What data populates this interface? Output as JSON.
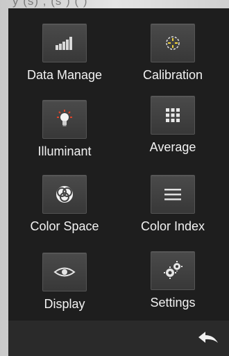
{
  "top_text": "y (s) , (s ) ( )",
  "menu": {
    "items": [
      {
        "label": "Data Manage",
        "icon": "bar-chart-icon"
      },
      {
        "label": "Calibration",
        "icon": "crosshair-icon"
      },
      {
        "label": "Illuminant",
        "icon": "lightbulb-icon"
      },
      {
        "label": "Average",
        "icon": "grid-dots-icon"
      },
      {
        "label": "Color Space",
        "icon": "color-circles-icon"
      },
      {
        "label": "Color Index",
        "icon": "lines-icon"
      },
      {
        "label": "Display",
        "icon": "eye-icon"
      },
      {
        "label": "Settings",
        "icon": "gears-icon"
      }
    ]
  },
  "bottom_bar": {
    "back_icon": "back-arrow-icon"
  },
  "colors": {
    "screen_bg": "#1e1e1e",
    "icon_tile": "#404040",
    "label_text": "#f2f2f2",
    "accent_red": "#e0442a",
    "accent_yellow": "#f0d23a"
  }
}
